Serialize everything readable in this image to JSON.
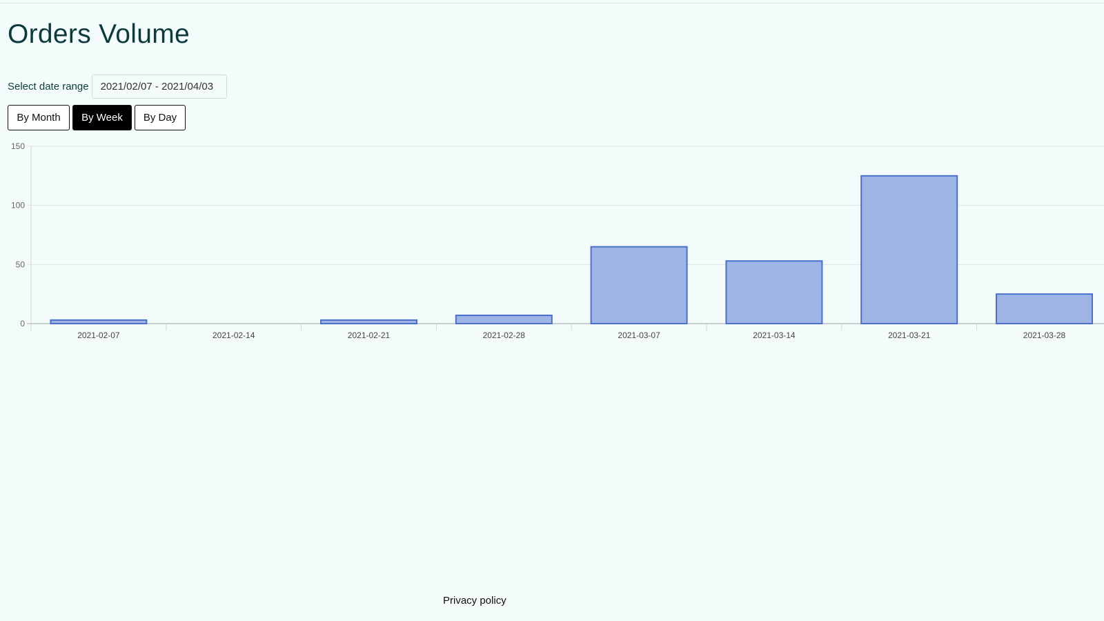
{
  "page": {
    "title": "Orders Volume"
  },
  "date_range": {
    "label": "Select date range",
    "value": "2021/02/07 - 2021/04/03"
  },
  "period_buttons": {
    "month": "By Month",
    "week": "By Week",
    "day": "By Day",
    "active": "week"
  },
  "footer": {
    "privacy_label": "Privacy policy"
  },
  "colors": {
    "bar_fill": "#9db4e5",
    "bar_stroke": "#4a6fcc",
    "background": "#f3fcfb",
    "active_button": "#000000"
  },
  "chart_data": {
    "type": "bar",
    "categories": [
      "2021-02-07",
      "2021-02-14",
      "2021-02-21",
      "2021-02-28",
      "2021-03-07",
      "2021-03-14",
      "2021-03-21",
      "2021-03-28"
    ],
    "values": [
      3,
      0,
      3,
      7,
      65,
      53,
      125,
      25
    ],
    "ylim": [
      0,
      150
    ],
    "yticks": [
      0,
      50,
      100,
      150
    ],
    "grid": true
  }
}
